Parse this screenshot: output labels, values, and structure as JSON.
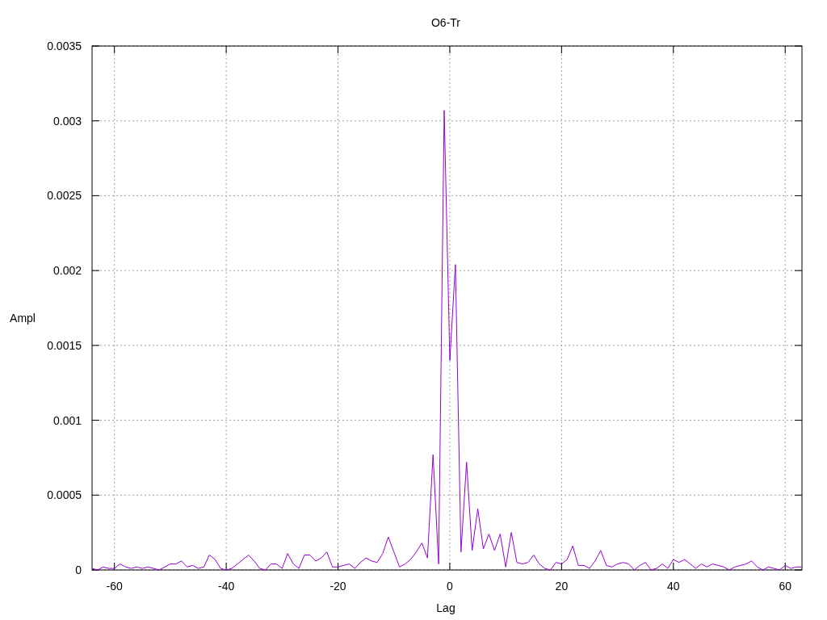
{
  "chart_data": {
    "type": "line",
    "grid": true,
    "title": "O6-Tr",
    "xlabel": "Lag",
    "ylabel": "Ampl",
    "xlim": [
      -64,
      63
    ],
    "ylim": [
      0,
      0.0035
    ],
    "xticks": [
      -60,
      -40,
      -20,
      0,
      20,
      40,
      60
    ],
    "yticks": [
      {
        "value": 0,
        "label": "0"
      },
      {
        "value": 0.0005,
        "label": "0.0005"
      },
      {
        "value": 0.001,
        "label": "0.001"
      },
      {
        "value": 0.0015,
        "label": "0.0015"
      },
      {
        "value": 0.002,
        "label": "0.002"
      },
      {
        "value": 0.0025,
        "label": "0.0025"
      },
      {
        "value": 0.003,
        "label": "0.003"
      },
      {
        "value": 0.0035,
        "label": "0.0035"
      }
    ],
    "x": [
      -64,
      -63,
      -62,
      -61,
      -60,
      -59,
      -58,
      -57,
      -56,
      -55,
      -54,
      -53,
      -52,
      -51,
      -50,
      -49,
      -48,
      -47,
      -46,
      -45,
      -44,
      -43,
      -42,
      -41,
      -40,
      -39,
      -38,
      -37,
      -36,
      -35,
      -34,
      -33,
      -32,
      -31,
      -30,
      -29,
      -28,
      -27,
      -26,
      -25,
      -24,
      -23,
      -22,
      -21,
      -20,
      -19,
      -18,
      -17,
      -16,
      -15,
      -14,
      -13,
      -12,
      -11,
      -10,
      -9,
      -8,
      -7,
      -6,
      -5,
      -4,
      -3,
      -2,
      -1,
      0,
      1,
      2,
      3,
      4,
      5,
      6,
      7,
      8,
      9,
      10,
      11,
      12,
      13,
      14,
      15,
      16,
      17,
      18,
      19,
      20,
      21,
      22,
      23,
      24,
      25,
      26,
      27,
      28,
      29,
      30,
      31,
      32,
      33,
      34,
      35,
      36,
      37,
      38,
      39,
      40,
      41,
      42,
      43,
      44,
      45,
      46,
      47,
      48,
      49,
      50,
      51,
      52,
      53,
      54,
      55,
      56,
      57,
      58,
      59,
      60,
      61,
      62,
      63
    ],
    "series": [
      {
        "color": "#9400d3",
        "values": [
          1e-05,
          0,
          2e-05,
          1e-05,
          1e-05,
          4e-05,
          2e-05,
          1e-05,
          2e-05,
          1e-05,
          2e-05,
          1e-05,
          0,
          2e-05,
          4e-05,
          4e-05,
          6e-05,
          2e-05,
          3e-05,
          1e-05,
          2e-05,
          0.0001,
          7e-05,
          1e-05,
          0,
          1e-05,
          4e-05,
          7e-05,
          0.0001,
          6e-05,
          1e-05,
          0,
          4e-05,
          4e-05,
          1e-05,
          0.00011,
          4e-05,
          1e-05,
          0.0001,
          0.0001,
          6e-05,
          8e-05,
          0.00012,
          2e-05,
          2e-05,
          3e-05,
          4e-05,
          1e-05,
          5e-05,
          8e-05,
          6e-05,
          5e-05,
          0.00011,
          0.00022,
          0.00012,
          2e-05,
          4e-05,
          7e-05,
          0.00012,
          0.00018,
          8e-05,
          0.00077,
          4e-05,
          0.00307,
          0.0014,
          0.00204,
          0.00012,
          0.00072,
          0.00013,
          0.00041,
          0.00014,
          0.00024,
          0.00013,
          0.00024,
          2e-05,
          0.00025,
          5e-05,
          4e-05,
          5e-05,
          0.0001,
          4e-05,
          1e-05,
          0,
          5e-05,
          4e-05,
          7e-05,
          0.00016,
          3e-05,
          3e-05,
          1e-05,
          6e-05,
          0.00013,
          3e-05,
          2e-05,
          4e-05,
          5e-05,
          4e-05,
          0,
          3e-05,
          5e-05,
          0,
          1e-05,
          4e-05,
          1e-05,
          7e-05,
          5e-05,
          7e-05,
          4e-05,
          1e-05,
          4e-05,
          2e-05,
          4e-05,
          3e-05,
          2e-05,
          0,
          2e-05,
          3e-05,
          4e-05,
          6e-05,
          2e-05,
          0,
          2e-05,
          1e-05,
          0,
          3e-05,
          1e-05,
          2e-05,
          2e-05
        ]
      }
    ]
  }
}
